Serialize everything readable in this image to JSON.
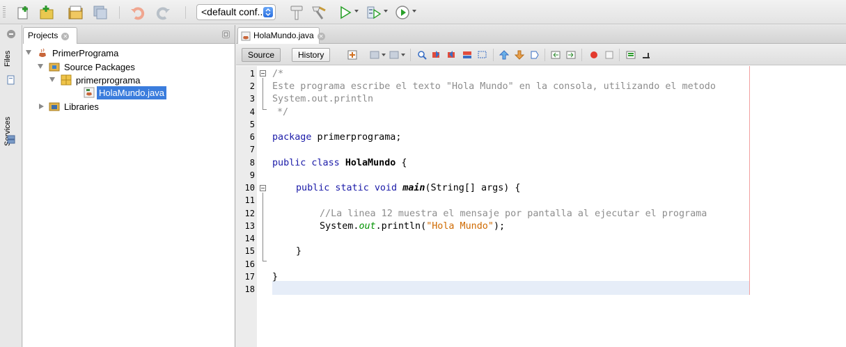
{
  "toolbar": {
    "config_selected": "<default conf...",
    "icons": [
      "new-file-icon",
      "new-project-icon",
      "open-project-icon",
      "save-all-icon",
      "undo-icon",
      "redo-icon",
      "build-icon",
      "clean-build-icon",
      "run-icon",
      "debug-icon",
      "profile-icon"
    ]
  },
  "side_strip": {
    "files_label": "Files",
    "services_label": "Services"
  },
  "projects_panel": {
    "tab_label": "Projects",
    "tree": {
      "project": "PrimerPrograma",
      "source_packages": "Source Packages",
      "package": "primerprograma",
      "file": "HolaMundo.java",
      "libraries": "Libraries"
    }
  },
  "editor": {
    "tab_label": "HolaMundo.java",
    "source_button": "Source",
    "history_button": "History",
    "line_numbers": [
      "1",
      "2",
      "3",
      "4",
      "5",
      "6",
      "7",
      "8",
      "9",
      "10",
      "11",
      "12",
      "13",
      "14",
      "15",
      "16",
      "17",
      "18"
    ],
    "code": {
      "l1": "/*",
      "l2": "Este programa escribe el texto \"Hola Mundo\" en la consola, utilizando el metodo",
      "l3": "System.out.println",
      "l4": "*/",
      "l6_kw": "package",
      "l6_rest": " primerprograma;",
      "l8_kw": "public class",
      "l8_name": "HolaMundo",
      "l8_rest": " {",
      "l10_kw": "public static void",
      "l10_name": "main",
      "l10_rest": "(String[] args) {",
      "l12": "//La linea 12 muestra el mensaje por pantalla al ejecutar el programa",
      "l13_a": "System.",
      "l13_field": "out",
      "l13_b": ".println(",
      "l13_str": "\"Hola Mundo\"",
      "l13_c": ");",
      "l15": "}",
      "l17": "}"
    }
  },
  "colors": {
    "keyword": "#1a1aa8",
    "comment": "#8c8c8c",
    "string": "#cf6a00",
    "field": "#009300",
    "selection": "#3b7ddd",
    "current_line": "#e6edf8"
  }
}
